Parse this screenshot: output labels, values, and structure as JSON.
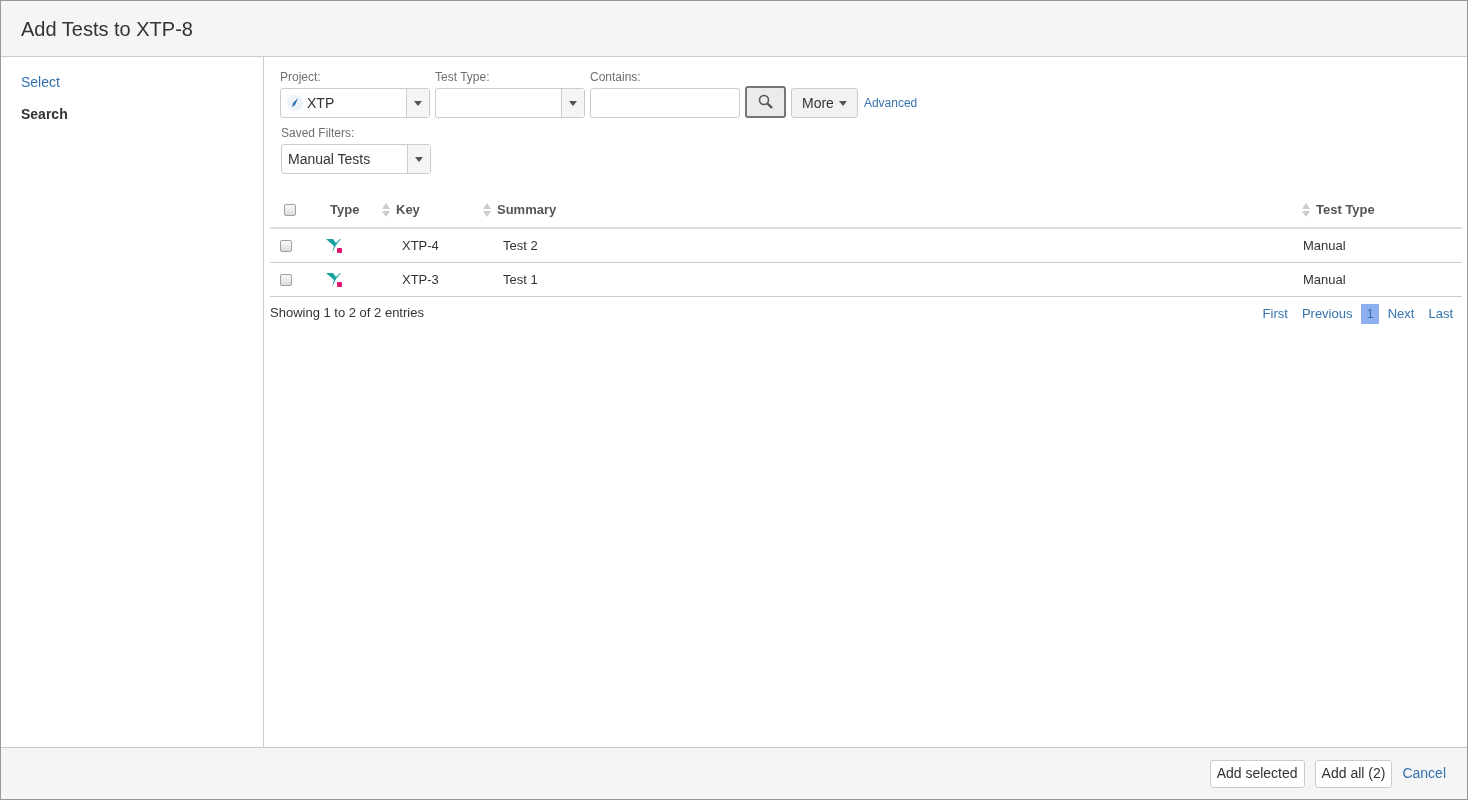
{
  "dialog": {
    "title": "Add Tests to XTP-8"
  },
  "sidebar": {
    "items": [
      {
        "label": "Select",
        "selected": false
      },
      {
        "label": "Search",
        "selected": true
      }
    ]
  },
  "filters": {
    "project": {
      "label": "Project:",
      "value": "XTP"
    },
    "test_type": {
      "label": "Test Type:"
    },
    "contains": {
      "label": "Contains:"
    },
    "more_button": "More",
    "advanced_link": "Advanced",
    "saved_filters": {
      "label": "Saved Filters:",
      "value": "Manual Tests"
    }
  },
  "table": {
    "select_all_checked": false,
    "columns": [
      {
        "label": "Type",
        "sortable": false
      },
      {
        "label": "Key",
        "sortable": true
      },
      {
        "label": "Summary",
        "sortable": true
      },
      {
        "label": "Test Type",
        "sortable": true
      }
    ],
    "rows": [
      {
        "checked": false,
        "key": "XTP-4",
        "summary": "Test 2",
        "test_type": "Manual"
      },
      {
        "checked": false,
        "key": "XTP-3",
        "summary": "Test 1",
        "test_type": "Manual"
      }
    ]
  },
  "info": "Showing 1 to 2 of 2 entries",
  "pagination": {
    "first": "First",
    "previous": "Previous",
    "pages": [
      {
        "label": "1",
        "selected": true
      }
    ],
    "next": "Next",
    "last": "Last"
  },
  "footer": {
    "add_selected": "Add selected",
    "add_all": "Add all (2)",
    "cancel": "Cancel"
  }
}
